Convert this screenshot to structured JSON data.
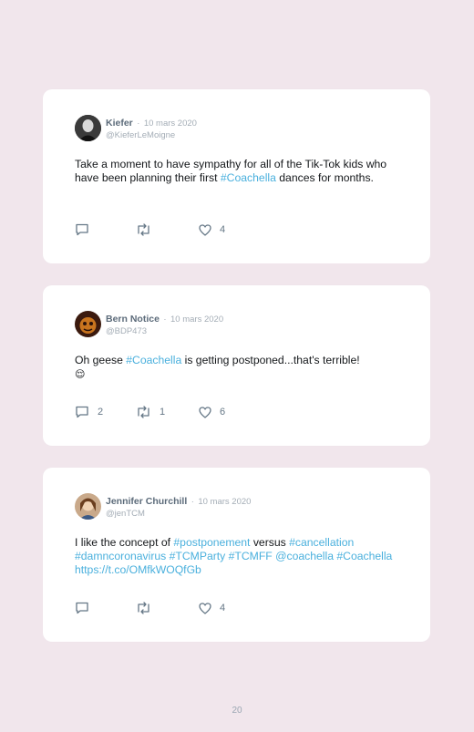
{
  "tweets": [
    {
      "name": "Kiefer",
      "separator": "·",
      "date": "10 mars 2020",
      "handle": "@KieferLeMoigne",
      "text": {
        "t1": "Take a moment to have sympathy for all of the Tik-Tok kids who have been planning their first ",
        "h1": "#Coachella",
        "t2": " dances for months."
      },
      "replies": "",
      "retweets": "",
      "likes": "4"
    },
    {
      "name": "Bern Notice",
      "separator": "·",
      "date": "10 mars 2020",
      "handle": "@BDP473",
      "text": {
        "t1": "Oh geese ",
        "h1": "#Coachella",
        "t2": " is getting postponed...that's terrible!",
        "emoji": "😌"
      },
      "replies": "2",
      "retweets": "1",
      "likes": "6"
    },
    {
      "name": "Jennifer Churchill",
      "separator": "·",
      "date": "10 mars 2020",
      "handle": "@jenTCM",
      "text": {
        "t1": "I like the concept of ",
        "h1": "#postponement",
        "t2": " versus ",
        "h2": "#cancellation",
        "h3": "#damncoronavirus #TCMParty #TCMFF @coachella #Coachella https://t.co/OMfkWOQfGb"
      },
      "replies": "",
      "retweets": "",
      "likes": "4"
    }
  ],
  "page_number": "20",
  "colors": {
    "background": "#f1e6ec",
    "card": "#ffffff",
    "hashtag": "#4ab0dd",
    "name": "#5c6b7a",
    "muted": "#a4adb6"
  }
}
